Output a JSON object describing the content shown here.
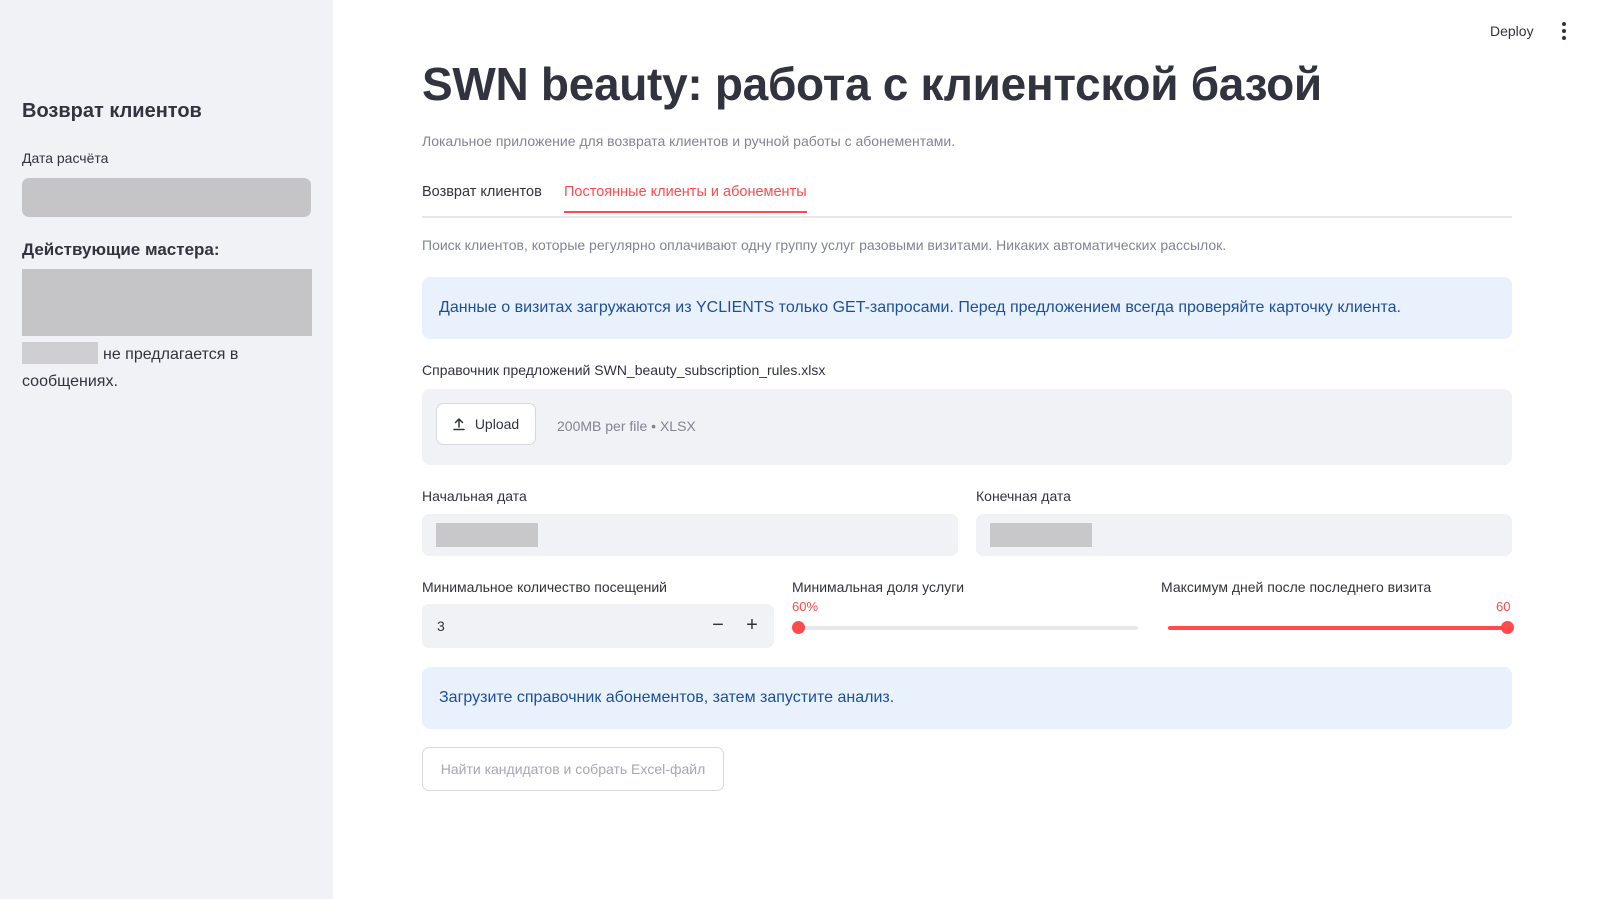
{
  "header": {
    "deploy_label": "Deploy",
    "menu_icon": "vertical-dots-icon"
  },
  "sidebar": {
    "title": "Возврат клиентов",
    "date_label": "Дата расчёта",
    "masters_label": "Действующие мастера:",
    "note_text": "не предлагается в сообщениях."
  },
  "main": {
    "title": "SWN beauty: работа с клиентской базой",
    "caption": "Локальное приложение для возврата клиентов и ручной работы с абонементами.",
    "tabs": [
      {
        "label": "Возврат клиентов",
        "active": false
      },
      {
        "label": "Постоянные клиенты и абонементы",
        "active": true
      }
    ],
    "description": "Поиск клиентов, которые регулярно оплачивают одну группу услуг разовыми визитами. Никаких автоматических рассылок.",
    "info_alert": "Данные о визитах загружаются из YCLIENTS только GET-запросами. Перед предложением всегда проверяйте карточку клиента.",
    "uploader": {
      "label": "Справочник предложений SWN_beauty_subscription_rules.xlsx",
      "button_label": "Upload",
      "button_icon": "upload-icon",
      "hint": "200MB per file • XLSX"
    },
    "start_date_label": "Начальная дата",
    "end_date_label": "Конечная дата",
    "min_visits": {
      "label": "Минимальное количество посещений",
      "value": "3",
      "minus": "−",
      "plus": "+"
    },
    "min_share": {
      "label": "Минимальная доля услуги",
      "display": "60%",
      "fraction": 0
    },
    "max_days": {
      "label": "Максимум дней после последнего визита",
      "display": "60",
      "fraction": 1
    },
    "status_alert": "Загрузите справочник абонементов, затем запустите анализ.",
    "run_button": "Найти кандидатов и собрать Excel-файл"
  },
  "colors": {
    "accent": "#ff4b4b",
    "info_bg": "#e9f1fc",
    "info_text": "#1e4f9c",
    "sidebar_bg": "#f0f2f6"
  }
}
